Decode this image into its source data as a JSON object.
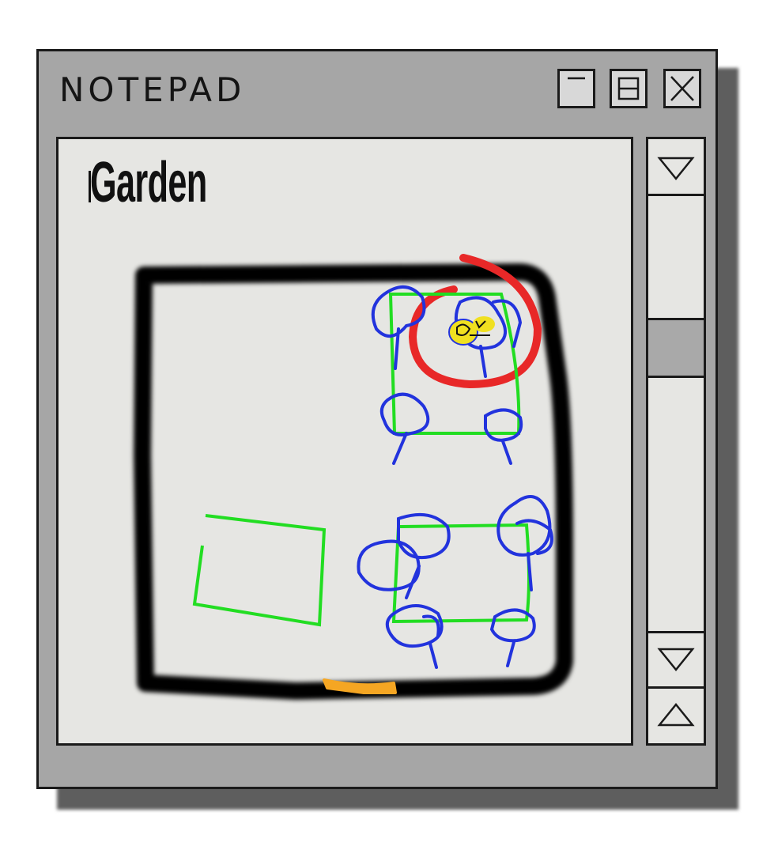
{
  "window": {
    "title": "NOTEPAD",
    "buttons": {
      "minimize": "minimize-icon",
      "maximize": "maximize-icon",
      "close": "close-icon"
    }
  },
  "document": {
    "title": "Garden"
  },
  "scrollbar": {
    "top_arrow": "triangle-down-icon",
    "bottom_down_arrow": "triangle-down-icon",
    "bottom_up_arrow": "triangle-up-icon"
  },
  "colors": {
    "window_gray": "#a6a6a6",
    "content_bg": "#e6e6e3",
    "border_outline": "#000000",
    "plot_green": "#22dd22",
    "plant_blue": "#2233dd",
    "circle_red": "#e82828",
    "highlight_yellow": "#f0e020",
    "gate_orange": "#f5a623"
  }
}
